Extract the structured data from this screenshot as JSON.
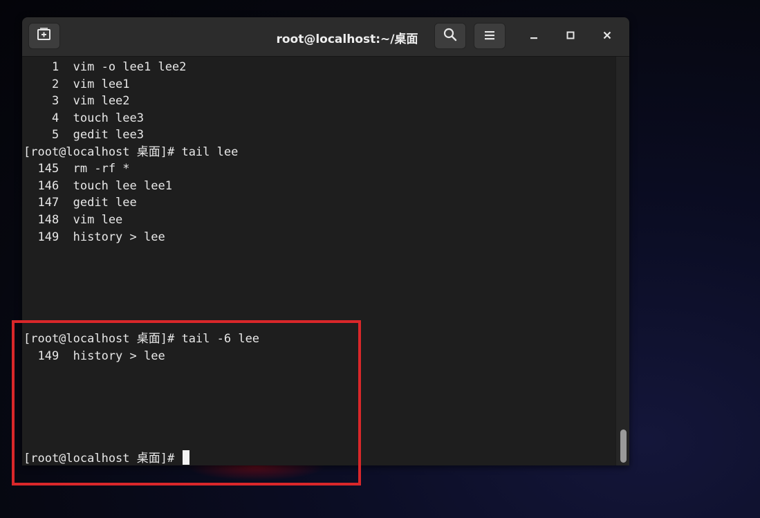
{
  "window": {
    "title": "root@localhost:~/桌面",
    "buttons": {
      "new_tab": "new-tab-icon",
      "search": "search-icon",
      "menu": "hamburger-menu-icon",
      "minimize": "minimize-icon",
      "maximize": "maximize-icon",
      "close": "close-icon"
    }
  },
  "terminal": {
    "lines": [
      "    1  vim -o lee1 lee2",
      "    2  vim lee1",
      "    3  vim lee2",
      "    4  touch lee3",
      "    5  gedit lee3",
      "[root@localhost 桌面]# tail lee",
      "  145  rm -rf *",
      "  146  touch lee lee1",
      "  147  gedit lee",
      "  148  vim lee",
      "  149  history > lee",
      "[root@localhost 桌面]# tail -6 lee",
      "  149  history > lee",
      "[root@localhost 桌面]# "
    ]
  },
  "colors": {
    "annotation_box": "#d9272a",
    "terminal_bg": "#1e1e1e",
    "titlebar_bg": "#2c2c2c"
  }
}
